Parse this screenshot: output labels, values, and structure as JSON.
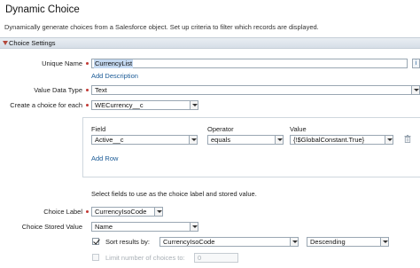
{
  "dialog": {
    "title": "Dynamic Choice",
    "description": "Dynamically generate choices from a Salesforce object. Set up criteria to filter which records are displayed."
  },
  "section": {
    "label": "Choice Settings"
  },
  "unique_name": {
    "label": "Unique Name",
    "value": "CurrencyList",
    "info_label": "i"
  },
  "add_description": "Add Description",
  "value_data_type": {
    "label": "Value Data Type",
    "value": "Text"
  },
  "create_choice_for": {
    "label": "Create a choice for each",
    "value": "WECurrency__c"
  },
  "filter": {
    "headers": {
      "field": "Field",
      "operator": "Operator",
      "value": "Value"
    },
    "row": {
      "field": "Active__c",
      "operator": "equals",
      "value": "{!$GlobalConstant.True}"
    },
    "add_row": "Add Row"
  },
  "select_fields_text": "Select fields to use as the choice label and stored value.",
  "choice_label": {
    "label": "Choice Label",
    "value": "CurrencyIsoCode"
  },
  "choice_stored_value": {
    "label": "Choice Stored Value",
    "value": "Name"
  },
  "sort": {
    "label": "Sort results by:",
    "checked": true,
    "field": "CurrencyIsoCode",
    "order": "Descending"
  },
  "limit": {
    "label": "Limit number of choices to:",
    "checked": false,
    "value": "0"
  },
  "colors": {
    "required": "#c23934",
    "link": "#1a5a96",
    "section_bg": "#dbe3ea"
  },
  "icons": [
    "trash-icon",
    "info-icon",
    "collapse-triangle-icon"
  ]
}
